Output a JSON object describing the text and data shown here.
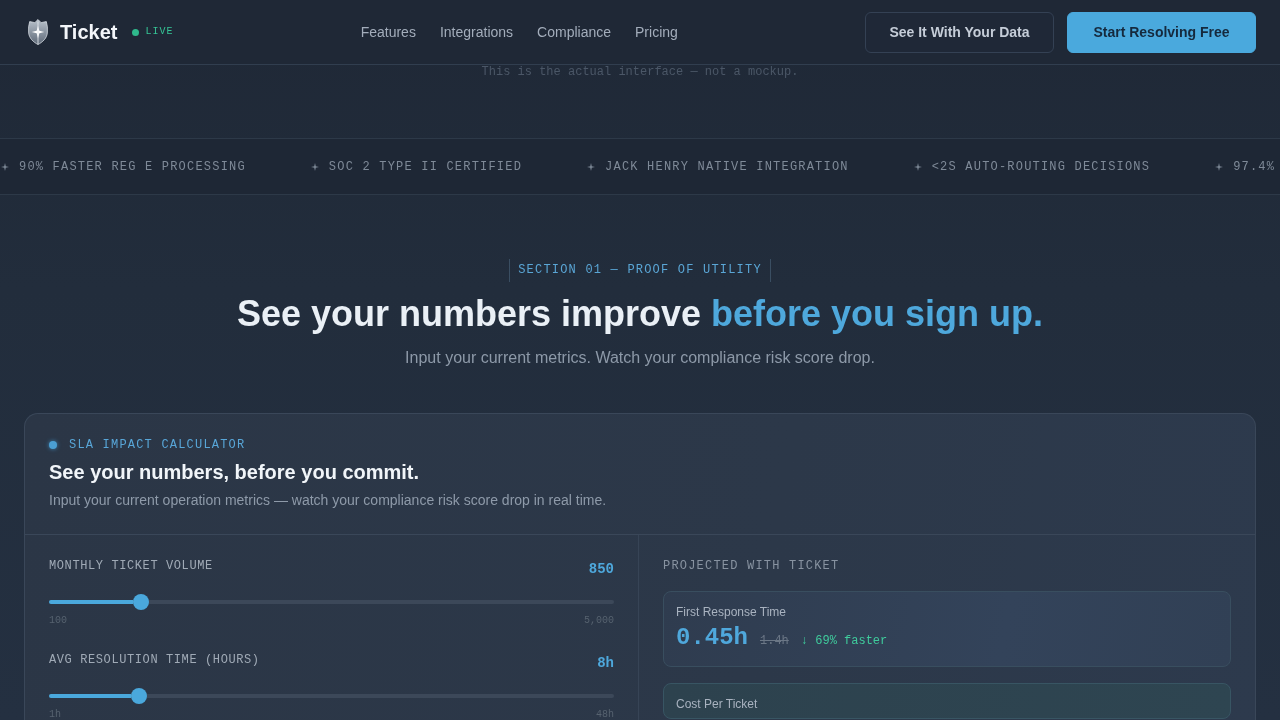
{
  "nav": {
    "brand": "Ticket",
    "status": "LIVE",
    "links": [
      "Features",
      "Integrations",
      "Compliance",
      "Pricing"
    ],
    "buttons": [
      {
        "label": "See It With Your Data",
        "kind": "secondary"
      },
      {
        "label": "Start Resolving Free",
        "kind": "primary"
      }
    ]
  },
  "caption": "This is the actual interface — not a mockup.",
  "ticker": [
    "90% FASTER REG E PROCESSING",
    "SOC 2 TYPE II CERTIFIED",
    "JACK HENRY NATIVE INTEGRATION",
    "<2S AUTO-ROUTING DECISIONS",
    "97.4%"
  ],
  "section": {
    "eyebrow": "SECTION 01 — PROOF OF UTILITY",
    "title": "See your numbers improve",
    "title_highlight": "before you sign up.",
    "subtitle": "Input your current metrics. Watch your compliance risk score drop."
  },
  "calculator": {
    "tag": "SLA IMPACT CALCULATOR",
    "title": "See your numbers, before you commit.",
    "description": "Input your current operation metrics — watch your compliance risk score drop in real time.",
    "inputs": [
      {
        "label": "MONTHLY TICKET VOLUME",
        "value": "850",
        "level": 0.153,
        "min": "100",
        "max": "5,000"
      },
      {
        "label": "AVG RESOLUTION TIME (HOURS)",
        "value": "8h",
        "level": 0.149,
        "min": "1h",
        "max": "48h"
      }
    ],
    "results": {
      "heading": "PROJECTED WITH TICKET",
      "metrics": [
        {
          "label": "First Response Time",
          "value": "0.45h",
          "previous": "1.4h",
          "change": "↓ 69% faster"
        },
        {
          "label": "Cost Per Ticket"
        }
      ]
    }
  }
}
